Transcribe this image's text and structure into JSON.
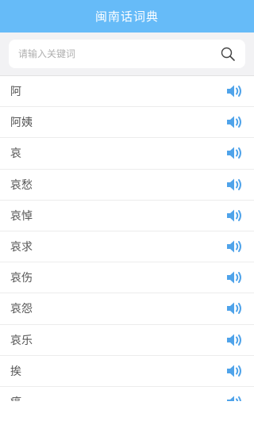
{
  "header": {
    "title": "闽南话词典"
  },
  "search": {
    "placeholder": "请输入关键词",
    "value": ""
  },
  "icons": {
    "search": "search-icon",
    "speaker": "speaker-icon"
  },
  "colors": {
    "header_bg": "#66bbf8",
    "speaker": "#4fa3ea"
  },
  "words": [
    {
      "label": "阿"
    },
    {
      "label": "阿姨"
    },
    {
      "label": "哀"
    },
    {
      "label": "哀愁"
    },
    {
      "label": "哀悼"
    },
    {
      "label": "哀求"
    },
    {
      "label": "哀伤"
    },
    {
      "label": "哀怨"
    },
    {
      "label": "哀乐"
    },
    {
      "label": "挨"
    },
    {
      "label": "癌"
    }
  ]
}
